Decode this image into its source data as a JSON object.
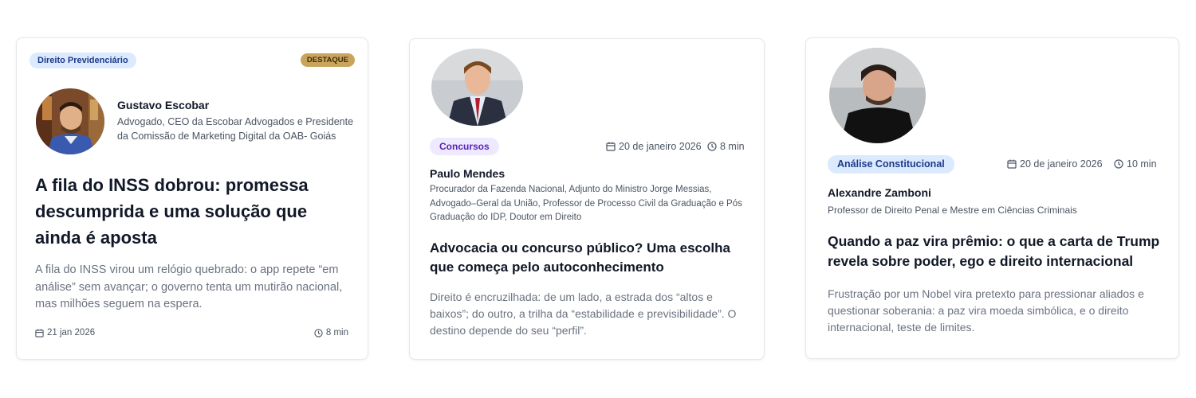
{
  "cards": [
    {
      "category": "Direito Previdenciário",
      "badge": "DESTAQUE",
      "author_name": "Gustavo Escobar",
      "author_role": "Advogado, CEO da Escobar Advogados e Presidente da Comissão de Marketing Digital da OAB- Goiás",
      "title": "A fila do INSS dobrou: promessa descumprida e uma solução que ainda é aposta",
      "excerpt": "A fila do INSS virou um relógio quebrado: o app repete “em análise” sem avançar; o governo tenta um mutirão nacional, mas milhões seguem na espera.",
      "date": "21 jan 2026",
      "read_time": "8 min"
    },
    {
      "category": "Concursos",
      "date": "20 de janeiro 2026",
      "read_time": "8 min",
      "author_name": "Paulo Mendes",
      "author_role": "Procurador da Fazenda Nacional, Adjunto do Ministro Jorge Messias, Advogado–Geral da União, Professor de Processo Civil da Graduação e Pós Graduação do IDP, Doutor em Direito",
      "title": "Advocacia ou concurso público? Uma escolha que começa pelo autoconhecimento",
      "excerpt": "Direito é encruzilhada: de um lado, a estrada dos “altos e baixos”; do outro, a trilha da “estabilidade e previsibilidade”. O destino depende do seu “perfil”."
    },
    {
      "category": "Análise Constitucional",
      "date": "20 de janeiro 2026",
      "read_time": "10 min",
      "author_name": "Alexandre Zamboni",
      "author_role": "Professor de Direito Penal e Mestre em Ciências Criminais",
      "title": "Quando a paz vira prêmio: o que a carta de Trump revela sobre poder, ego e direito internacional",
      "excerpt": "Frustração por um Nobel vira pretexto para pressionar aliados e questionar soberania: a paz vira moeda simbólica, e o direito internacional, teste de limites."
    }
  ],
  "colors": {
    "badge_blue_bg": "#dbeafe",
    "badge_blue_text": "#1e3a8a",
    "badge_purple_bg": "#ede9fe",
    "badge_purple_text": "#5b21b6",
    "destaque_bg": "#c9a45c",
    "destaque_text": "#3f2a0a"
  },
  "icons": {
    "date": "calendar-icon",
    "time": "clock-icon"
  }
}
